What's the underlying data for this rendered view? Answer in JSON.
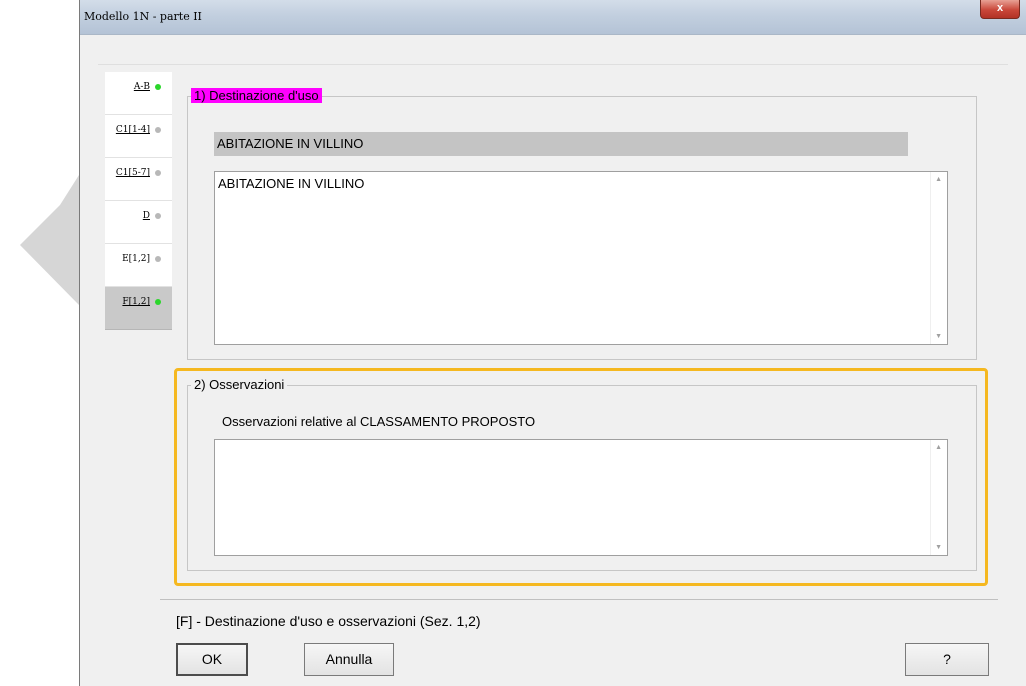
{
  "window": {
    "title": "Modello 1N  -  parte II",
    "close_label": "x"
  },
  "tabs": [
    {
      "label": "A-B",
      "status": "green",
      "underlined": true
    },
    {
      "label": "C1[1-4]",
      "status": "gray",
      "underlined": true
    },
    {
      "label": "C1[5-7]",
      "status": "gray",
      "underlined": true
    },
    {
      "label": "D",
      "status": "gray",
      "underlined": true
    },
    {
      "label": "E[1,2]",
      "status": "gray",
      "underlined": false
    },
    {
      "label": "F[1,2]",
      "status": "green",
      "underlined": true,
      "selected": true
    }
  ],
  "section1": {
    "legend": "1) Destinazione d'uso",
    "field_value": "ABITAZIONE IN VILLINO",
    "textarea_value": "ABITAZIONE IN VILLINO"
  },
  "section2": {
    "legend": "2) Osservazioni",
    "label": "Osservazioni relative al CLASSAMENTO PROPOSTO",
    "textarea_value": ""
  },
  "footer": {
    "description": "[F] - Destinazione d'uso e osservazioni (Sez. 1,2)",
    "ok_label": "OK",
    "cancel_label": "Annulla",
    "help_label": "?"
  },
  "colors": {
    "legend_highlight": "#ff00ff",
    "annotation_box": "#f5b820",
    "status_green": "#2bd62b",
    "status_gray": "#b8b8b8"
  }
}
